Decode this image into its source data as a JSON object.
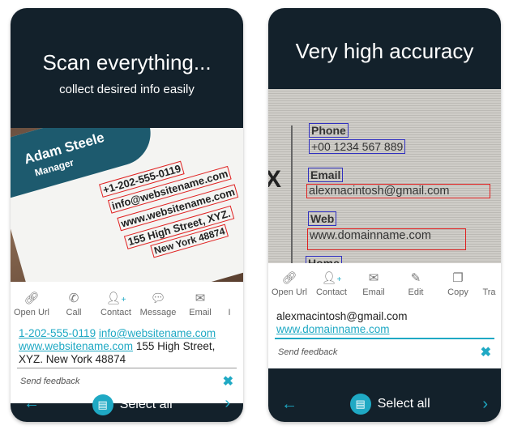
{
  "screens": [
    {
      "title": "Scan everything...",
      "subtitle": "collect desired info easily",
      "card": {
        "name": "Adam Steele",
        "role": "Manager",
        "lines": [
          "+1-202-555-0119",
          "info@websitename.com",
          "www.websitename.com",
          "155 High Street, XYZ.",
          "New York 48874"
        ]
      },
      "actions": [
        {
          "icon": "link-icon",
          "label": "Open Url"
        },
        {
          "icon": "phone-icon",
          "label": "Call"
        },
        {
          "icon": "add-contact-icon",
          "label": "Contact"
        },
        {
          "icon": "sms-icon",
          "label": "Message"
        },
        {
          "icon": "email-icon",
          "label": "Email"
        },
        {
          "icon": "",
          "label": "I"
        }
      ],
      "result": {
        "phone": "1-202-555-0119",
        "email": "info@websitename.com",
        "web": "www.websitename.com",
        "address1": " 155 High Street,",
        "address2": "XYZ. New York 48874"
      },
      "feedback": "Send feedback",
      "select_all": "Select all"
    },
    {
      "title": "Very high accuracy",
      "card": {
        "phone_label": "Phone",
        "phone": "+00 1234 567 889",
        "email_label": "Email",
        "email": "alexmacintosh@gmail.com",
        "web_label": "Web",
        "web": "www.domainname.com",
        "home_label": "Home"
      },
      "actions": [
        {
          "icon": "link-icon",
          "label": "Open Url"
        },
        {
          "icon": "add-contact-icon",
          "label": "Contact"
        },
        {
          "icon": "email-icon",
          "label": "Email"
        },
        {
          "icon": "edit-icon",
          "label": "Edit"
        },
        {
          "icon": "copy-icon",
          "label": "Copy"
        },
        {
          "icon": "",
          "label": "Tra"
        }
      ],
      "result": {
        "email": "alexmacintosh@gmail.com",
        "web": "www.domainname.com"
      },
      "feedback": "Send feedback",
      "select_all": "Select all"
    }
  ],
  "colors": {
    "accent": "#1fa9c4",
    "dark": "#13212b",
    "box_red": "#e02020",
    "box_blue": "#3030c0"
  }
}
